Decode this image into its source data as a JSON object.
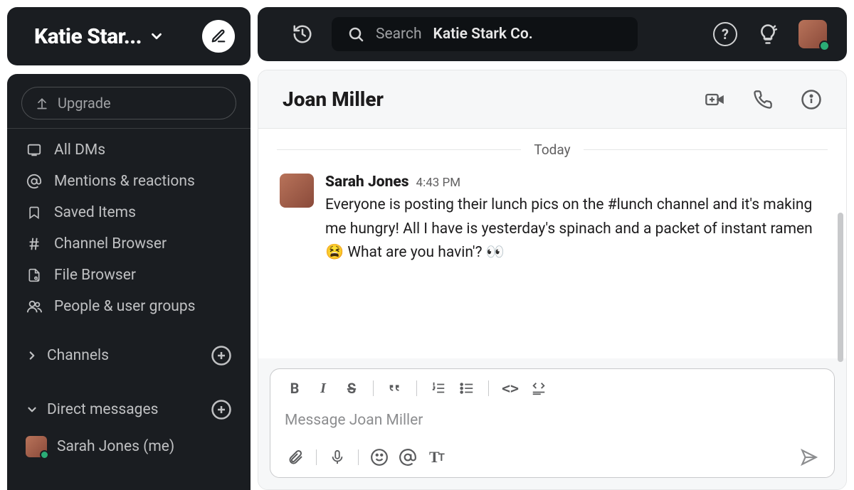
{
  "workspace": {
    "name_truncated": "Katie Star...",
    "search_placeholder_prefix": "Search",
    "search_placeholder_workspace": "Katie Stark Co."
  },
  "sidebar": {
    "upgrade_label": "Upgrade",
    "nav": [
      {
        "icon": "all-dms",
        "label": "All DMs"
      },
      {
        "icon": "mentions",
        "label": "Mentions & reactions"
      },
      {
        "icon": "saved",
        "label": "Saved Items"
      },
      {
        "icon": "channel-browser",
        "label": "Channel Browser"
      },
      {
        "icon": "file-browser",
        "label": "File Browser"
      },
      {
        "icon": "people",
        "label": "People & user groups"
      }
    ],
    "sections": {
      "channels_label": "Channels",
      "dms_label": "Direct messages"
    },
    "dms": [
      {
        "name": "Sarah Jones (me)",
        "presence": "active"
      }
    ]
  },
  "conversation": {
    "title": "Joan Miller",
    "date_divider": "Today",
    "messages": [
      {
        "author": "Sarah Jones",
        "time": "4:43 PM",
        "text": "Everyone is posting their lunch pics on the #lunch channel and it's making me hungry! All I have is yesterday's spinach and a packet of instant ramen 😫 What are you havin'? 👀"
      }
    ],
    "composer_placeholder": "Message Joan Miller"
  },
  "icons": {
    "chevron_down": "chevron-down",
    "compose": "pencil",
    "history": "clock-history",
    "help": "?",
    "hints": "lightbulb"
  }
}
